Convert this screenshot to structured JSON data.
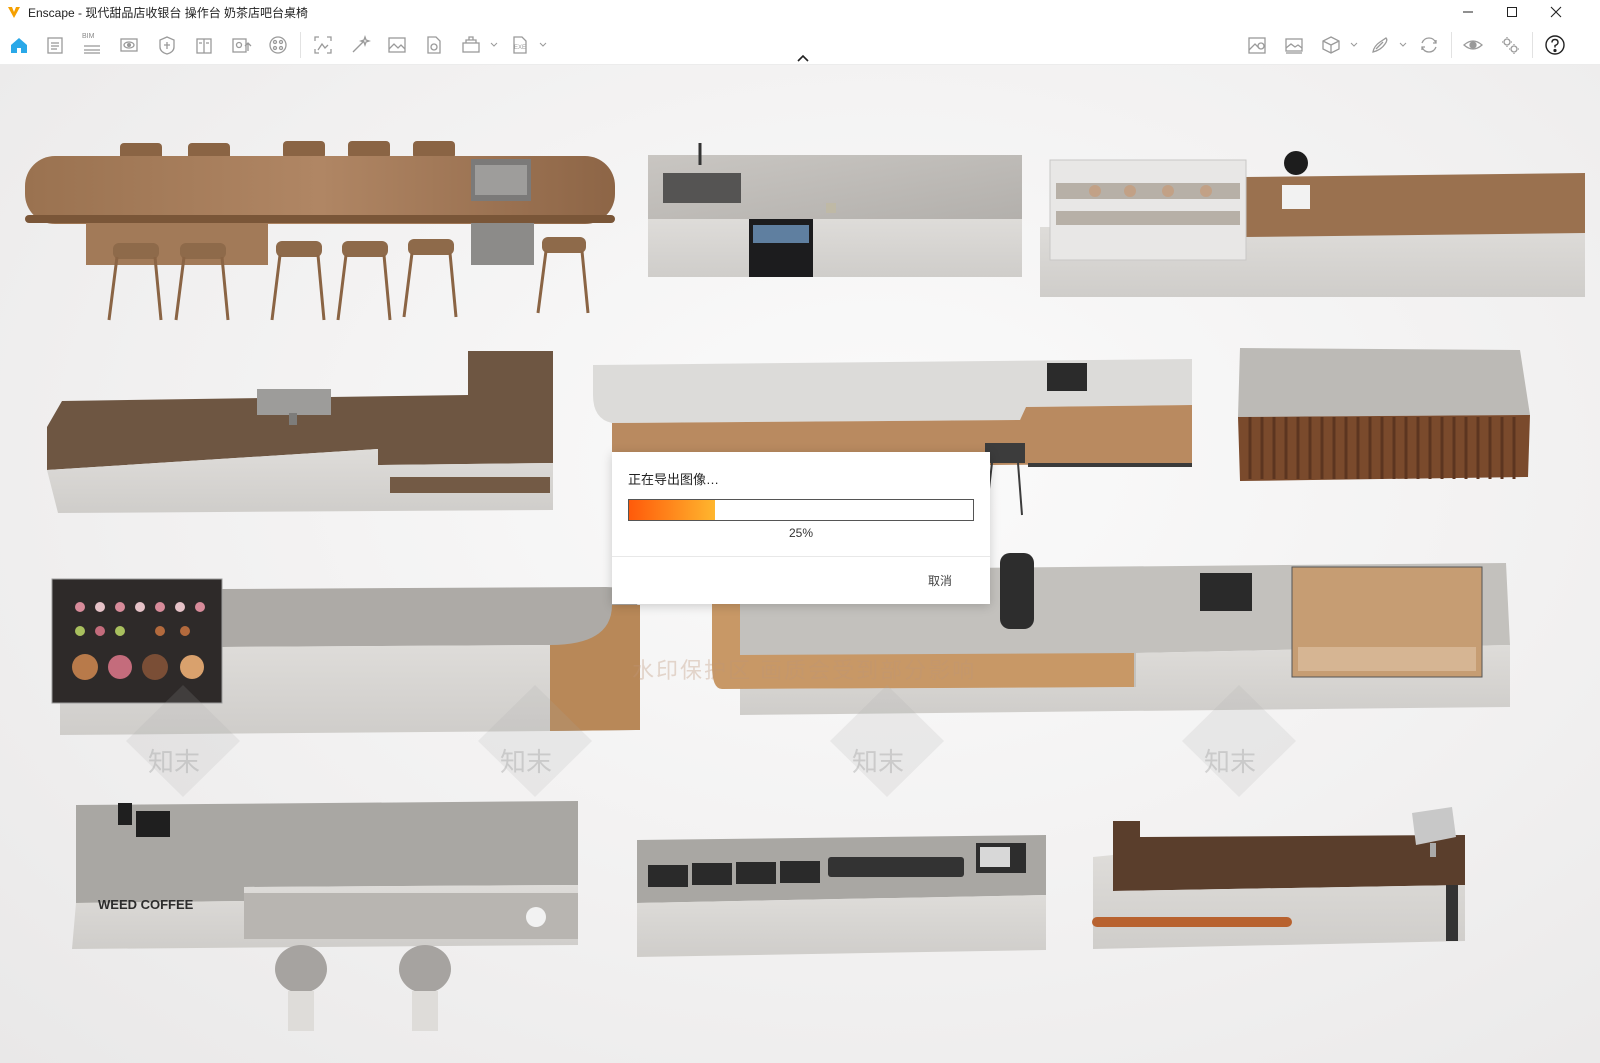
{
  "window": {
    "title": "Enscape - 现代甜品店收银台 操作台 奶茶店吧台桌椅",
    "controls": [
      "minimize-icon",
      "maximize-icon",
      "close-icon"
    ]
  },
  "toolbar": {
    "left_icons": [
      "home-icon",
      "document-icon",
      "bim-icon",
      "view-icon",
      "asset-icon",
      "book-icon",
      "upload-icon",
      "materials-icon",
      "capture-icon",
      "magic-icon",
      "image-icon",
      "file-icon",
      "batch-icon",
      "export-icon"
    ],
    "right_icons": [
      "map-icon",
      "gallery-icon",
      "cube-icon",
      "brush-icon",
      "sync-icon",
      "eye-icon",
      "settings-icon",
      "help-icon"
    ],
    "bim_label": "BIM",
    "export_badge": "EXE"
  },
  "viewport": {
    "watermark_text": "水印保护区 画质会受到部分影响",
    "watermark_logo_text": "知末",
    "scene_label": "WEED COFFEE",
    "colors": {
      "wood": "#8c6544",
      "wood_dark": "#5c4430",
      "stone": "#d8d6d3",
      "counter_top": "#bdbab6"
    }
  },
  "dialog": {
    "title": "正在导出图像…",
    "progress_fraction": 0.25,
    "progress_label": "25%",
    "cancel_label": "取消",
    "colors": {
      "progress_start": "#ff5a0a",
      "progress_end": "#ffb62e"
    }
  }
}
